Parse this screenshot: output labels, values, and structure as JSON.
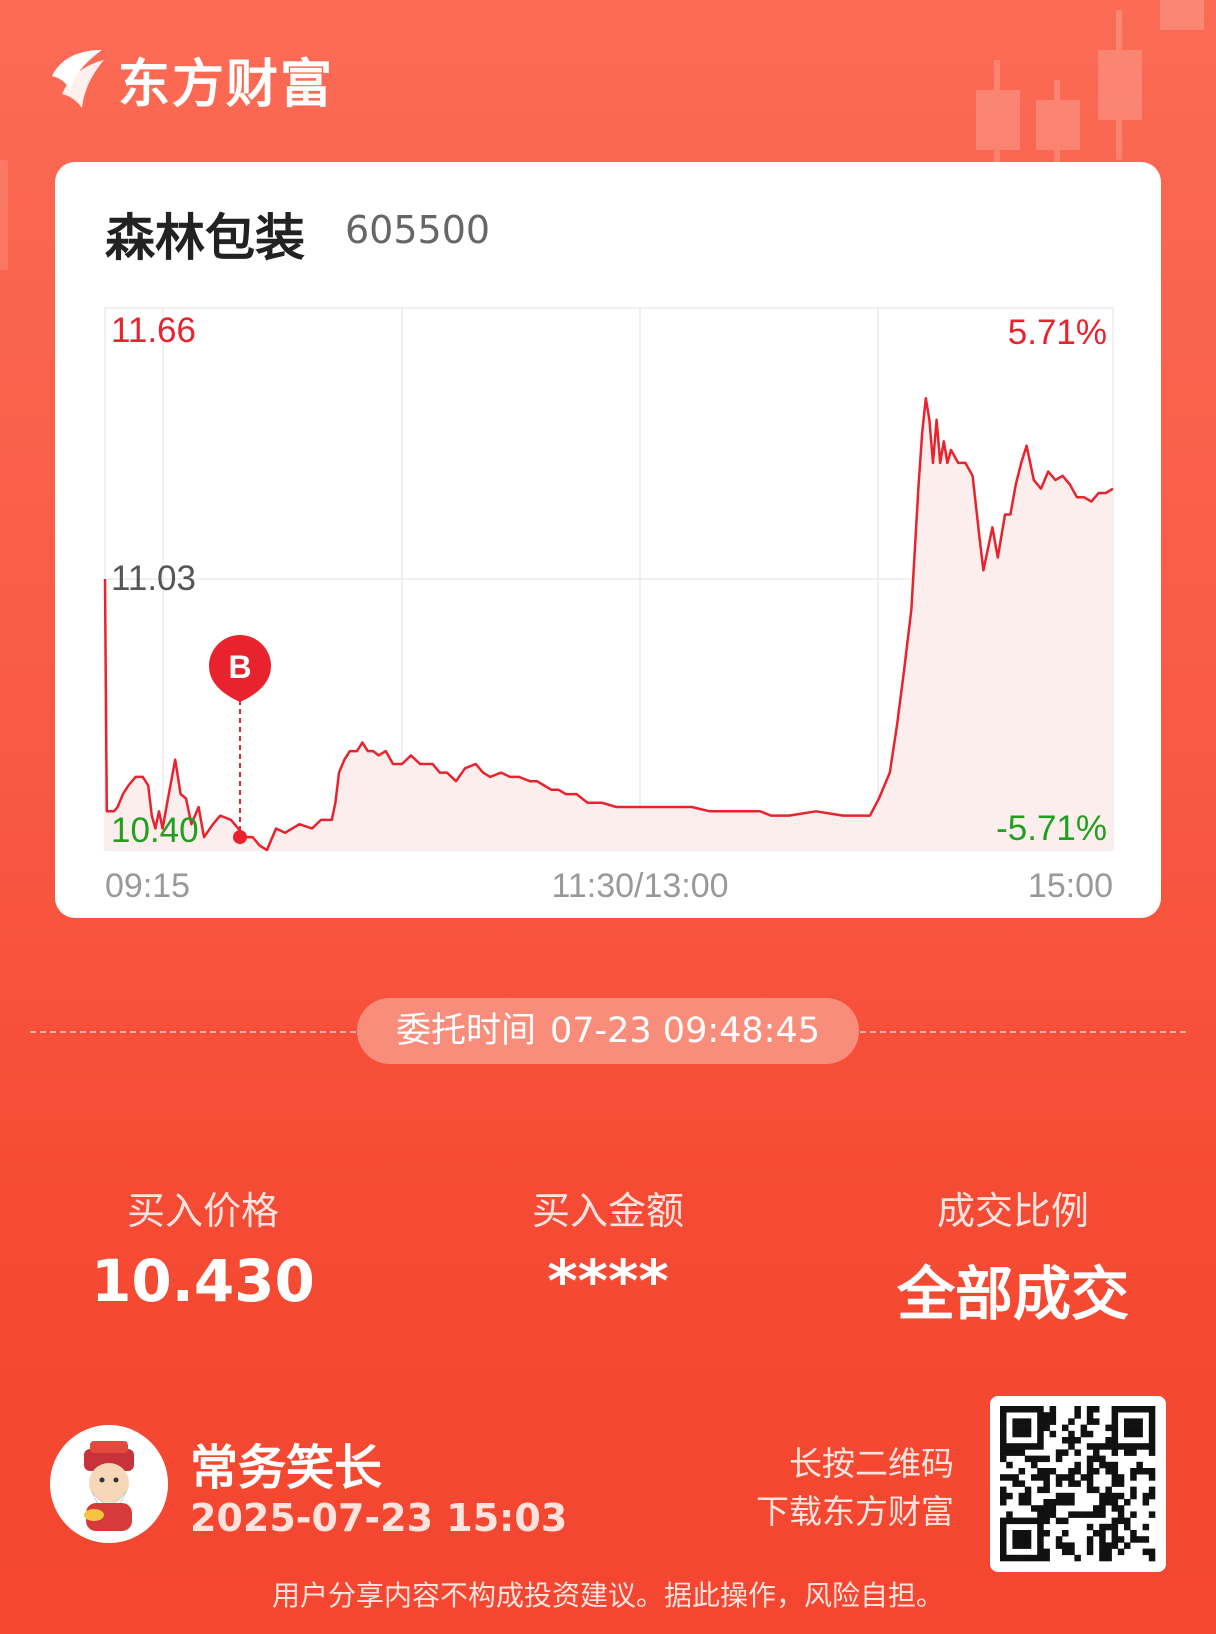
{
  "brand": {
    "name": "东方财富"
  },
  "stock": {
    "name": "森林包装",
    "code": "605500"
  },
  "chart_data": {
    "type": "line",
    "title": "森林包装 605500",
    "xlabel": "",
    "ylabel": "",
    "ylim": [
      10.4,
      11.66
    ],
    "y_tick_labels": [
      "11.66",
      "11.03",
      "10.40"
    ],
    "pct_tick_labels": [
      "5.71%",
      "-5.71%"
    ],
    "x_tick_labels": [
      "09:15",
      "11:30/13:00",
      "15:00"
    ],
    "grid": true,
    "series": [
      {
        "x": [
          0,
          1,
          3,
          5,
          7,
          10,
          13,
          17,
          21,
          24,
          26,
          28,
          30,
          32,
          35,
          39,
          42,
          45,
          48,
          52,
          55,
          60,
          64,
          70,
          74,
          78,
          82,
          86,
          90,
          95,
          100,
          108,
          115,
          120,
          126,
          128,
          130,
          133,
          136,
          140,
          143,
          146,
          149,
          152,
          156,
          160,
          165,
          170,
          175,
          178,
          182,
          186,
          190,
          195,
          200,
          206,
          210,
          214,
          220,
          225,
          230,
          236,
          240,
          244,
          248,
          252,
          256,
          262,
          268,
          276,
          284,
          290,
          296,
          302,
          310,
          318,
          326,
          336,
          346,
          352,
          358,
          364,
          370,
          380,
          395,
          410,
          425,
          430,
          436,
          440,
          444,
          448,
          452,
          454,
          456,
          458,
          460,
          462,
          464,
          466,
          468,
          470,
          474,
          478,
          482,
          486,
          488,
          490,
          493,
          496,
          500,
          503,
          506,
          509,
          512,
          514,
          516,
          520,
          524,
          528,
          532,
          536,
          540,
          544,
          548,
          552,
          556,
          560
        ],
        "y": [
          11.03,
          10.49,
          10.49,
          10.49,
          10.5,
          10.53,
          10.55,
          10.57,
          10.57,
          10.55,
          10.48,
          10.45,
          10.49,
          10.45,
          10.52,
          10.61,
          10.53,
          10.52,
          10.46,
          10.5,
          10.43,
          10.46,
          10.48,
          10.47,
          10.45,
          10.43,
          10.43,
          10.41,
          10.4,
          10.45,
          10.44,
          10.46,
          10.45,
          10.47,
          10.47,
          10.51,
          10.58,
          10.61,
          10.63,
          10.63,
          10.65,
          10.63,
          10.63,
          10.62,
          10.63,
          10.6,
          10.6,
          10.62,
          10.6,
          10.6,
          10.6,
          10.58,
          10.58,
          10.56,
          10.59,
          10.6,
          10.58,
          10.57,
          10.58,
          10.57,
          10.57,
          10.56,
          10.56,
          10.55,
          10.54,
          10.54,
          10.53,
          10.53,
          10.51,
          10.51,
          10.5,
          10.5,
          10.5,
          10.5,
          10.5,
          10.5,
          10.5,
          10.49,
          10.49,
          10.49,
          10.49,
          10.49,
          10.48,
          10.48,
          10.49,
          10.48,
          10.48,
          10.52,
          10.58,
          10.69,
          10.82,
          10.96,
          11.25,
          11.37,
          11.45,
          11.4,
          11.3,
          11.4,
          11.3,
          11.35,
          11.3,
          11.33,
          11.3,
          11.3,
          11.27,
          11.12,
          11.05,
          11.09,
          11.15,
          11.08,
          11.18,
          11.18,
          11.25,
          11.3,
          11.34,
          11.3,
          11.26,
          11.24,
          11.28,
          11.26,
          11.27,
          11.25,
          11.22,
          11.22,
          11.21,
          11.23,
          11.23,
          11.24
        ]
      }
    ],
    "x_max": 560,
    "buy_marker": {
      "label": "B",
      "x": 75,
      "y": 10.43
    },
    "line_color": "#e8232d",
    "fill_color": "#fdeeee"
  },
  "order": {
    "label": "委托时间",
    "time": "07-23 09:48:45"
  },
  "stats": [
    {
      "label": "买入价格",
      "value": "10.430"
    },
    {
      "label": "买入金额",
      "value": "****"
    },
    {
      "label": "成交比例",
      "value": "全部成交"
    }
  ],
  "user": {
    "name": "常务笑长",
    "share_time": "2025-07-23 15:03"
  },
  "qr": {
    "line1": "长按二维码",
    "line2": "下载东方财富"
  },
  "disclaimer": "用户分享内容不构成投资建议。据此操作，风险自担。",
  "colors": {
    "up": "#e8232d",
    "down": "#1fa01f",
    "neutral": "#555555"
  }
}
